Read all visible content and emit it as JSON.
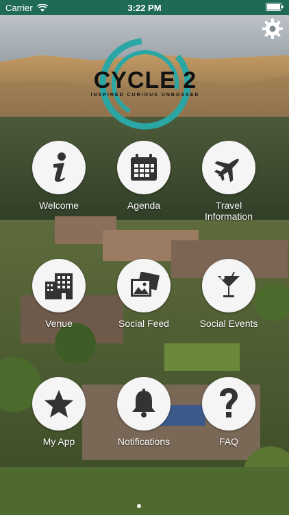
{
  "status": {
    "carrier": "Carrier",
    "time": "3:22 PM",
    "bar_color": "#1f6a57"
  },
  "logo": {
    "text": "CYCLE 2",
    "tagline": "INSPIRED CURIOUS UNBOSSED",
    "ring_color": "#2aa7a5"
  },
  "tiles": [
    {
      "label": "Welcome",
      "icon": "info-icon"
    },
    {
      "label": "Agenda",
      "icon": "calendar-icon"
    },
    {
      "label": "Travel\nInformation",
      "icon": "airplane-icon"
    },
    {
      "label": "Venue",
      "icon": "building-icon"
    },
    {
      "label": "Social Feed",
      "icon": "photos-icon"
    },
    {
      "label": "Social Events",
      "icon": "cocktail-icon"
    },
    {
      "label": "My App",
      "icon": "star-icon"
    },
    {
      "label": "Notifications",
      "icon": "bell-icon"
    },
    {
      "label": "FAQ",
      "icon": "question-icon"
    }
  ],
  "page_indicator": {
    "pages": 1,
    "current": 1
  },
  "settings_icon": "gear-icon"
}
